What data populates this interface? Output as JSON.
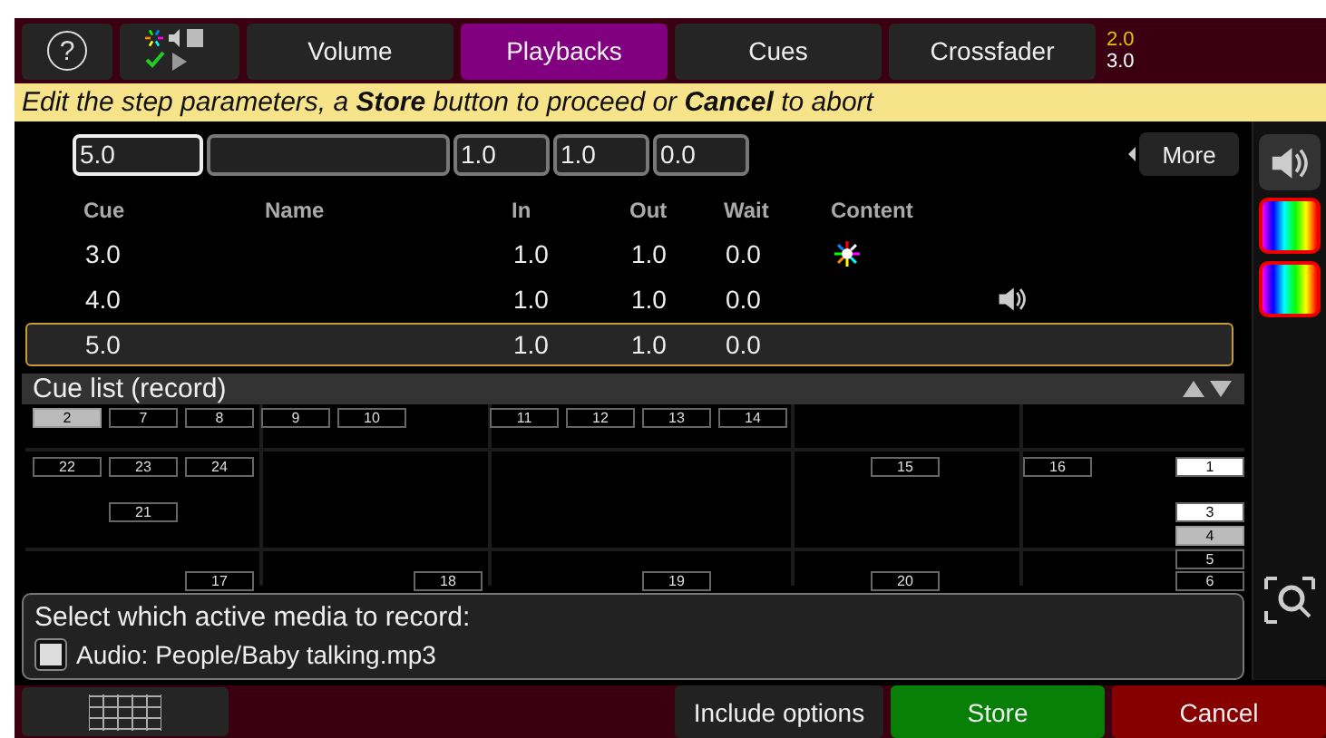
{
  "top_bar": {
    "help": "?",
    "tabs": [
      {
        "label": "Volume",
        "selected": false
      },
      {
        "label": "Playbacks",
        "selected": true
      },
      {
        "label": "Cues",
        "selected": false
      },
      {
        "label": "Crossfader",
        "selected": false
      }
    ],
    "cue_info": [
      "2.0",
      "3.0"
    ]
  },
  "instruction": "Edit the step parameters, a **Store** button to proceed or **Cancel** to abort",
  "edit_fields": [
    {
      "value": "5.0",
      "selected": true
    },
    {
      "selected": false
    },
    {
      "value": "1.0",
      "selected": false
    },
    {
      "value": "1.0",
      "selected": false
    },
    {
      "value": "0.0",
      "selected": false
    }
  ],
  "more_button": "More",
  "table": {
    "columns": [
      "Cue",
      "Name",
      "In",
      "Out",
      "Wait",
      "Content"
    ],
    "rows": [
      {
        "cue": "3.0",
        "in": "1.0",
        "out": "1.0",
        "wait": "0.0",
        "kind": "light",
        "selected": false
      },
      {
        "cue": "4.0",
        "in": "1.0",
        "out": "1.0",
        "wait": "0.0",
        "kind": "audio",
        "selected": false
      },
      {
        "cue": "5.0",
        "in": "1.0",
        "out": "1.0",
        "wait": "0.0",
        "selected": true
      }
    ]
  },
  "cue_list": {
    "title": "Cue list (record)",
    "playbacks": [
      {
        "label": "2",
        "selected": true,
        "active": false
      },
      {
        "label": "7",
        "selected": false,
        "active": false
      },
      {
        "label": "8",
        "selected": false,
        "active": false
      },
      {
        "label": "9",
        "selected": false,
        "active": false
      },
      {
        "label": "10",
        "selected": false,
        "active": false
      },
      {
        "label": "11",
        "selected": false,
        "active": false
      },
      {
        "label": "12",
        "selected": false,
        "active": false
      },
      {
        "label": "13",
        "selected": false,
        "active": false
      },
      {
        "label": "14",
        "selected": false,
        "active": false
      },
      {
        "label": "22",
        "selected": false,
        "active": false
      },
      {
        "label": "23",
        "selected": false,
        "active": false
      },
      {
        "label": "24",
        "selected": false,
        "active": false
      },
      {
        "label": "15",
        "selected": false,
        "active": false
      },
      {
        "label": "16",
        "selected": false,
        "active": false
      },
      {
        "label": "1",
        "selected": false,
        "active": true
      },
      {
        "label": "21",
        "selected": false,
        "active": false
      },
      {
        "label": "3",
        "selected": false,
        "active": true
      },
      {
        "label": "4",
        "selected": true,
        "active": false
      },
      {
        "label": "5",
        "selected": false,
        "active": false
      },
      {
        "label": "17",
        "selected": false,
        "active": false
      },
      {
        "label": "18",
        "selected": false,
        "active": false
      },
      {
        "label": "19",
        "selected": false,
        "active": false
      },
      {
        "label": "20",
        "selected": false,
        "active": false
      },
      {
        "label": "6",
        "selected": false,
        "active": false
      }
    ]
  },
  "media_panel": {
    "prompt": "Select which active media to record:",
    "items": [
      {
        "label": "Audio: People/Baby talking.mp3",
        "checked": false
      }
    ]
  },
  "bottom_bar": {
    "buttons": [
      {
        "label": "Include options",
        "kind": "plain"
      },
      {
        "label": "Store",
        "kind": "store"
      },
      {
        "label": "Cancel",
        "kind": "cancel"
      }
    ]
  }
}
